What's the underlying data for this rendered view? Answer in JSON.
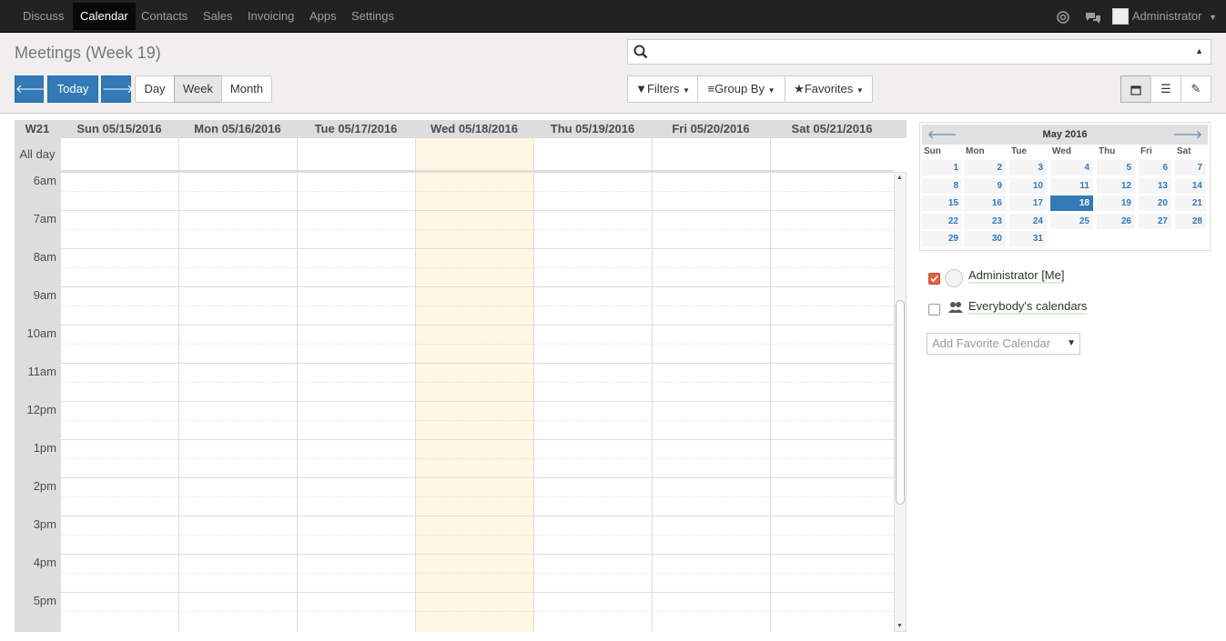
{
  "nav": {
    "items": [
      "Discuss",
      "Calendar",
      "Contacts",
      "Sales",
      "Invoicing",
      "Apps",
      "Settings"
    ],
    "active": "Calendar",
    "user": "Administrator"
  },
  "control": {
    "title": "Meetings (Week 19)",
    "today_label": "Today",
    "view_day": "Day",
    "view_week": "Week",
    "view_month": "Month",
    "filters_label": "Filters",
    "groupby_label": "Group By",
    "favorites_label": "Favorites",
    "search_placeholder": ""
  },
  "calendar": {
    "week_label": "W21",
    "allday_label": "All day",
    "days": [
      "Sun 05/15/2016",
      "Mon 05/16/2016",
      "Tue 05/17/2016",
      "Wed 05/18/2016",
      "Thu 05/19/2016",
      "Fri 05/20/2016",
      "Sat 05/21/2016"
    ],
    "highlight_day": "Wed 05/18/2016",
    "hours": [
      "6am",
      "7am",
      "8am",
      "9am",
      "10am",
      "11am",
      "12pm",
      "1pm",
      "2pm",
      "3pm",
      "4pm",
      "5pm"
    ],
    "today_color": "#fcf8e3"
  },
  "mini_calendar": {
    "title": "May 2016",
    "dow": [
      "Sun",
      "Mon",
      "Tue",
      "Wed",
      "Thu",
      "Fri",
      "Sat"
    ],
    "weeks": [
      [
        "1",
        "2",
        "3",
        "4",
        "5",
        "6",
        "7"
      ],
      [
        "8",
        "9",
        "10",
        "11",
        "12",
        "13",
        "14"
      ],
      [
        "15",
        "16",
        "17",
        "18",
        "19",
        "20",
        "21"
      ],
      [
        "22",
        "23",
        "24",
        "25",
        "26",
        "27",
        "28"
      ],
      [
        "29",
        "30",
        "31",
        "",
        "",
        "",
        ""
      ]
    ],
    "selected": "18"
  },
  "filters": {
    "admin_label": "Administrator [Me]",
    "everybody_label": "Everybody's calendars",
    "add_favorite": "Add Favorite Calendar"
  },
  "colors": {
    "navbar": "#222222",
    "primary": "#337ab7",
    "accent_checkbox": "#e8603c"
  }
}
